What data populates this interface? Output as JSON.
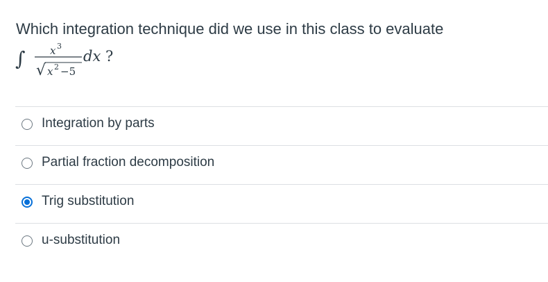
{
  "question": {
    "text": "Which integration technique did we use in this class to evaluate",
    "formula": {
      "integral_sign": "∫",
      "numerator_base": "x",
      "numerator_exponent": "3",
      "denominator_radical": "√",
      "denominator_base": "x",
      "denominator_exponent": "2",
      "denominator_rest": "−5",
      "differential": "dx",
      "question_mark": "?"
    }
  },
  "answers": [
    {
      "label": "Integration by parts",
      "selected": false
    },
    {
      "label": "Partial fraction decomposition",
      "selected": false
    },
    {
      "label": "Trig substitution",
      "selected": true
    },
    {
      "label": "u-substitution",
      "selected": false
    }
  ],
  "colors": {
    "text": "#2d3b45",
    "selected_radio": "#0770d8",
    "divider": "#dcdfe3"
  }
}
